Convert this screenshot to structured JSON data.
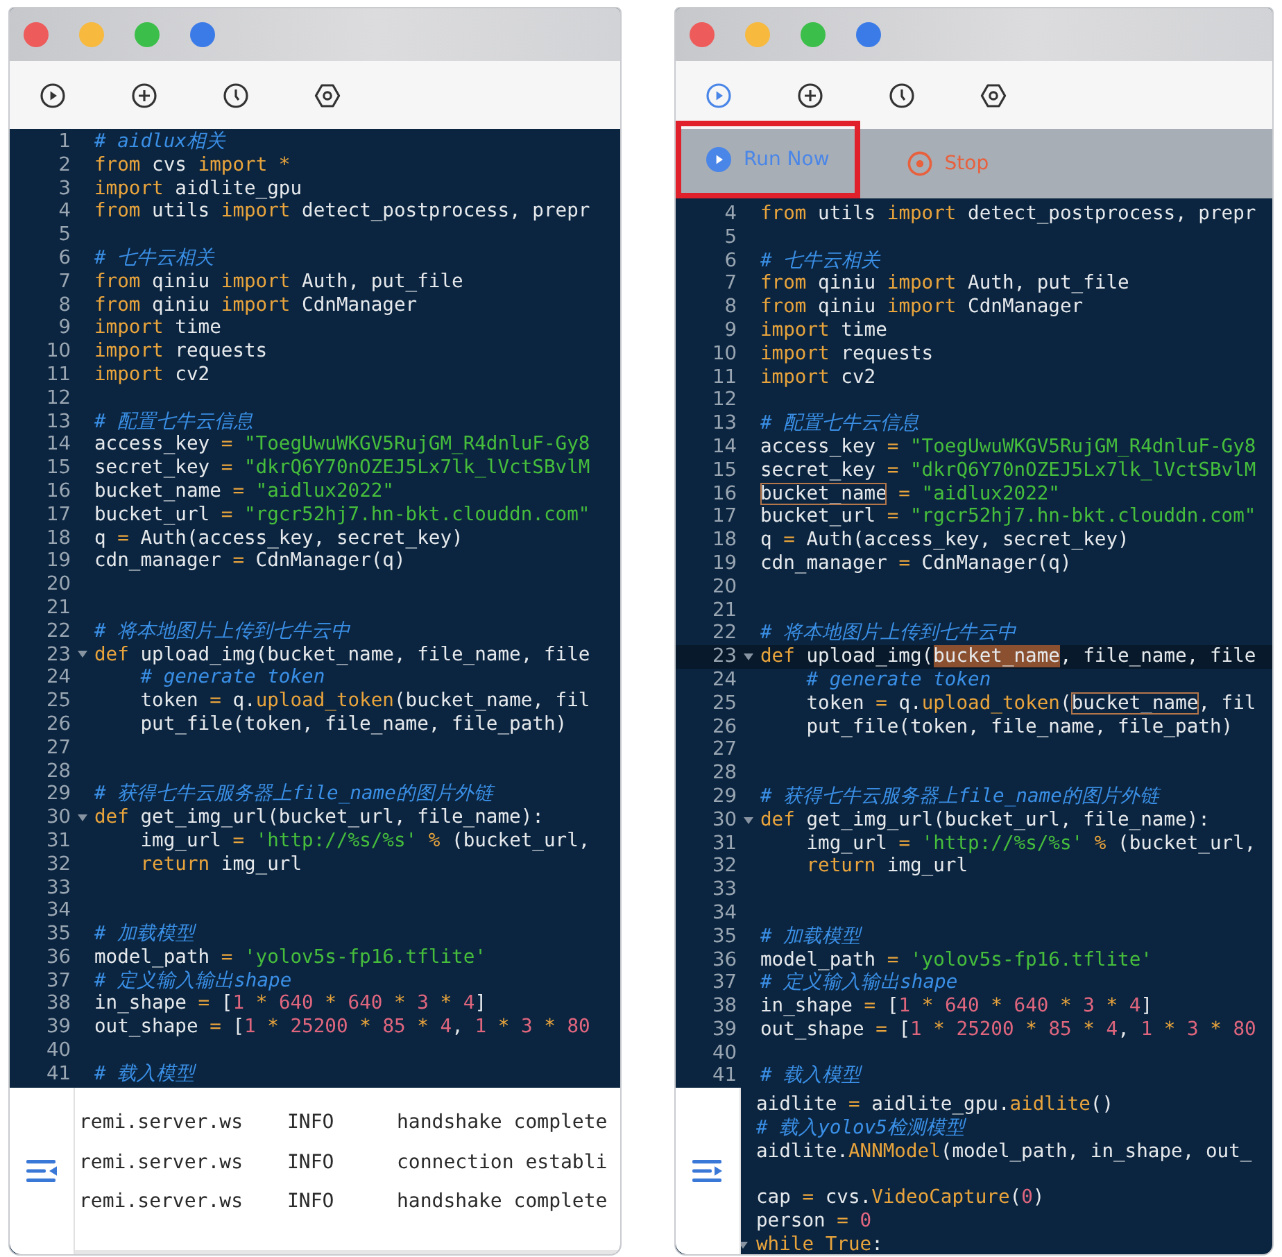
{
  "windows": [
    {
      "window_buttons": [
        {
          "color": "#ee5b5b"
        },
        {
          "color": "#f7b93e"
        },
        {
          "color": "#3cbf4a"
        },
        {
          "color": "#3b7be8"
        }
      ],
      "toolbar": [
        {
          "kind": "run",
          "selected": false
        },
        {
          "kind": "add",
          "selected": false
        },
        {
          "kind": "history",
          "selected": false
        },
        {
          "kind": "settings",
          "selected": false
        }
      ],
      "editor": {
        "lines": [
          {
            "number": "1",
            "foldable": false,
            "tokens": [
              {
                "text": "# aidlux相关",
                "kind": "comment"
              }
            ]
          },
          {
            "number": "2",
            "foldable": false,
            "tokens": [
              {
                "text": "from",
                "kind": "keyword"
              },
              {
                "text": " cvs ",
                "kind": "plain"
              },
              {
                "text": "import",
                "kind": "keyword"
              },
              {
                "text": " *",
                "kind": "operator"
              }
            ]
          },
          {
            "number": "3",
            "foldable": false,
            "tokens": [
              {
                "text": "import",
                "kind": "keyword"
              },
              {
                "text": " aidlite_gpu",
                "kind": "plain"
              }
            ]
          },
          {
            "number": "4",
            "foldable": false,
            "tokens": [
              {
                "text": "from",
                "kind": "keyword"
              },
              {
                "text": " utils ",
                "kind": "plain"
              },
              {
                "text": "import",
                "kind": "keyword"
              },
              {
                "text": " detect_postprocess, prepr",
                "kind": "plain"
              }
            ]
          },
          {
            "number": "5",
            "foldable": false
          },
          {
            "number": "6",
            "foldable": false,
            "tokens": [
              {
                "text": "# 七牛云相关",
                "kind": "comment"
              }
            ]
          },
          {
            "number": "7",
            "foldable": false,
            "tokens": [
              {
                "text": "from",
                "kind": "keyword"
              },
              {
                "text": " qiniu ",
                "kind": "plain"
              },
              {
                "text": "import",
                "kind": "keyword"
              },
              {
                "text": " Auth, put_file",
                "kind": "plain"
              }
            ]
          },
          {
            "number": "8",
            "foldable": false,
            "tokens": [
              {
                "text": "from",
                "kind": "keyword"
              },
              {
                "text": " qiniu ",
                "kind": "plain"
              },
              {
                "text": "import",
                "kind": "keyword"
              },
              {
                "text": " CdnManager",
                "kind": "plain"
              }
            ]
          },
          {
            "number": "9",
            "foldable": false,
            "tokens": [
              {
                "text": "import",
                "kind": "keyword"
              },
              {
                "text": " time",
                "kind": "plain"
              }
            ]
          },
          {
            "number": "10",
            "foldable": false,
            "tokens": [
              {
                "text": "import",
                "kind": "keyword"
              },
              {
                "text": " requests",
                "kind": "plain"
              }
            ]
          },
          {
            "number": "11",
            "foldable": false,
            "tokens": [
              {
                "text": "import",
                "kind": "keyword"
              },
              {
                "text": " cv2",
                "kind": "plain"
              }
            ]
          },
          {
            "number": "12",
            "foldable": false
          },
          {
            "number": "13",
            "foldable": false,
            "tokens": [
              {
                "text": "# 配置七牛云信息",
                "kind": "comment"
              }
            ]
          },
          {
            "number": "14",
            "foldable": false,
            "tokens": [
              {
                "text": "access_key ",
                "kind": "plain"
              },
              {
                "text": "=",
                "kind": "operator"
              },
              {
                "text": " \"ToegUwuWKGV5RujGM_R4dnluF-Gy8",
                "kind": "string"
              }
            ]
          },
          {
            "number": "15",
            "foldable": false,
            "tokens": [
              {
                "text": "secret_key ",
                "kind": "plain"
              },
              {
                "text": "=",
                "kind": "operator"
              },
              {
                "text": " \"dkrQ6Y70nOZEJ5Lx7lk_lVctSBvlM",
                "kind": "string"
              }
            ]
          },
          {
            "number": "16",
            "foldable": false,
            "tokens": [
              {
                "text": "bucket_name ",
                "kind": "plain"
              },
              {
                "text": "=",
                "kind": "operator"
              },
              {
                "text": " \"aidlux2022\"",
                "kind": "string"
              }
            ]
          },
          {
            "number": "17",
            "foldable": false,
            "tokens": [
              {
                "text": "bucket_url ",
                "kind": "plain"
              },
              {
                "text": "=",
                "kind": "operator"
              },
              {
                "text": " \"rgcr52hj7.hn-bkt.clouddn.com\"",
                "kind": "string"
              }
            ]
          },
          {
            "number": "18",
            "foldable": false,
            "tokens": [
              {
                "text": "q ",
                "kind": "plain"
              },
              {
                "text": "=",
                "kind": "operator"
              },
              {
                "text": " Auth(access_key, secret_key)",
                "kind": "plain"
              }
            ]
          },
          {
            "number": "19",
            "foldable": false,
            "tokens": [
              {
                "text": "cdn_manager ",
                "kind": "plain"
              },
              {
                "text": "=",
                "kind": "operator"
              },
              {
                "text": " CdnManager(q)",
                "kind": "plain"
              }
            ]
          },
          {
            "number": "20",
            "foldable": false
          },
          {
            "number": "21",
            "foldable": false
          },
          {
            "number": "22",
            "foldable": false,
            "tokens": [
              {
                "text": "# 将本地图片上传到七牛云中",
                "kind": "comment"
              }
            ]
          },
          {
            "number": "23",
            "foldable": true,
            "tokens": [
              {
                "text": "def",
                "kind": "keyword"
              },
              {
                "text": " upload_img(bucket_name, file_name, file",
                "kind": "plain"
              }
            ]
          },
          {
            "number": "24",
            "foldable": false,
            "tokens": [
              {
                "text": "    # generate token",
                "kind": "comment"
              }
            ]
          },
          {
            "number": "25",
            "foldable": false,
            "tokens": [
              {
                "text": "    token ",
                "kind": "plain"
              },
              {
                "text": "=",
                "kind": "operator"
              },
              {
                "text": " q.",
                "kind": "plain"
              },
              {
                "text": "upload_token",
                "kind": "call"
              },
              {
                "text": "(bucket_name, fil",
                "kind": "plain"
              }
            ]
          },
          {
            "number": "26",
            "foldable": false,
            "tokens": [
              {
                "text": "    put_file(token, file_name, file_path)",
                "kind": "plain"
              }
            ]
          },
          {
            "number": "27",
            "foldable": false
          },
          {
            "number": "28",
            "foldable": false
          },
          {
            "number": "29",
            "foldable": false,
            "tokens": [
              {
                "text": "# 获得七牛云服务器上file_name的图片外链",
                "kind": "comment"
              }
            ]
          },
          {
            "number": "30",
            "foldable": true,
            "tokens": [
              {
                "text": "def",
                "kind": "keyword"
              },
              {
                "text": " get_img_url(bucket_url, file_name):",
                "kind": "plain"
              }
            ]
          },
          {
            "number": "31",
            "foldable": false,
            "tokens": [
              {
                "text": "    img_url ",
                "kind": "plain"
              },
              {
                "text": "=",
                "kind": "operator"
              },
              {
                "text": " 'http://%s/%s'",
                "kind": "string"
              },
              {
                "text": " %",
                "kind": "operator"
              },
              {
                "text": " (bucket_url,",
                "kind": "plain"
              }
            ]
          },
          {
            "number": "32",
            "foldable": false,
            "tokens": [
              {
                "text": "    return",
                "kind": "keyword"
              },
              {
                "text": " img_url",
                "kind": "plain"
              }
            ]
          },
          {
            "number": "33",
            "foldable": false
          },
          {
            "number": "34",
            "foldable": false
          },
          {
            "number": "35",
            "foldable": false,
            "tokens": [
              {
                "text": "# 加载模型",
                "kind": "comment"
              }
            ]
          },
          {
            "number": "36",
            "foldable": false,
            "tokens": [
              {
                "text": "model_path ",
                "kind": "plain"
              },
              {
                "text": "=",
                "kind": "operator"
              },
              {
                "text": " 'yolov5s-fp16.tflite'",
                "kind": "string"
              }
            ]
          },
          {
            "number": "37",
            "foldable": false,
            "tokens": [
              {
                "text": "# 定义输入输出shape",
                "kind": "comment"
              }
            ]
          },
          {
            "number": "38",
            "foldable": false,
            "tokens": [
              {
                "text": "in_shape ",
                "kind": "plain"
              },
              {
                "text": "=",
                "kind": "operator"
              },
              {
                "text": " [",
                "kind": "plain"
              },
              {
                "text": "1",
                "kind": "number"
              },
              {
                "text": " *",
                "kind": "operator"
              },
              {
                "text": " 640",
                "kind": "number"
              },
              {
                "text": " *",
                "kind": "operator"
              },
              {
                "text": " 640",
                "kind": "number"
              },
              {
                "text": " *",
                "kind": "operator"
              },
              {
                "text": " 3",
                "kind": "number"
              },
              {
                "text": " *",
                "kind": "operator"
              },
              {
                "text": " 4",
                "kind": "number"
              },
              {
                "text": "]",
                "kind": "plain"
              }
            ]
          },
          {
            "number": "39",
            "foldable": false,
            "tokens": [
              {
                "text": "out_shape ",
                "kind": "plain"
              },
              {
                "text": "=",
                "kind": "operator"
              },
              {
                "text": " [",
                "kind": "plain"
              },
              {
                "text": "1",
                "kind": "number"
              },
              {
                "text": " *",
                "kind": "operator"
              },
              {
                "text": " 25200",
                "kind": "number"
              },
              {
                "text": " *",
                "kind": "operator"
              },
              {
                "text": " 85",
                "kind": "number"
              },
              {
                "text": " *",
                "kind": "operator"
              },
              {
                "text": " 4",
                "kind": "number"
              },
              {
                "text": ",",
                "kind": "plain"
              },
              {
                "text": " 1",
                "kind": "number"
              },
              {
                "text": " *",
                "kind": "operator"
              },
              {
                "text": " 3",
                "kind": "number"
              },
              {
                "text": " *",
                "kind": "operator"
              },
              {
                "text": " 80",
                "kind": "number"
              }
            ]
          },
          {
            "number": "40",
            "foldable": false
          },
          {
            "number": "41",
            "foldable": false,
            "tokens": [
              {
                "text": "# 载入模型",
                "kind": "comment"
              }
            ]
          }
        ]
      },
      "log_panel": {
        "expanded": true,
        "rows": [
          {
            "logger": "remi.server.ws",
            "severity": "INFO",
            "message": "handshake complete"
          },
          {
            "logger": "remi.server.ws",
            "severity": "INFO",
            "message": "connection establi"
          },
          {
            "logger": "remi.server.ws",
            "severity": "INFO",
            "message": "handshake complete"
          }
        ]
      }
    },
    {
      "window_buttons": [
        {
          "color": "#ee5b5b"
        },
        {
          "color": "#f7b93e"
        },
        {
          "color": "#3cbf4a"
        },
        {
          "color": "#3b7be8"
        }
      ],
      "toolbar": [
        {
          "kind": "run",
          "selected": true
        },
        {
          "kind": "add",
          "selected": false
        },
        {
          "kind": "history",
          "selected": false
        },
        {
          "kind": "settings",
          "selected": false
        }
      ],
      "action_bar": [
        {
          "kind": "run",
          "label": "Run Now",
          "highlighted": true
        },
        {
          "kind": "stop",
          "label": "Stop",
          "highlighted": false
        }
      ],
      "editor": {
        "lines": [
          {
            "number": "4",
            "foldable": false,
            "current": false,
            "tokens": [
              {
                "text": "from",
                "kind": "keyword"
              },
              {
                "text": " utils ",
                "kind": "plain"
              },
              {
                "text": "import",
                "kind": "keyword"
              },
              {
                "text": " detect_postprocess, prepr",
                "kind": "plain"
              }
            ]
          },
          {
            "number": "5",
            "foldable": false,
            "current": false
          },
          {
            "number": "6",
            "foldable": false,
            "current": false,
            "tokens": [
              {
                "text": "# 七牛云相关",
                "kind": "comment"
              }
            ]
          },
          {
            "number": "7",
            "foldable": false,
            "current": false,
            "tokens": [
              {
                "text": "from",
                "kind": "keyword"
              },
              {
                "text": " qiniu ",
                "kind": "plain"
              },
              {
                "text": "import",
                "kind": "keyword"
              },
              {
                "text": " Auth, put_file",
                "kind": "plain"
              }
            ]
          },
          {
            "number": "8",
            "foldable": false,
            "current": false,
            "tokens": [
              {
                "text": "from",
                "kind": "keyword"
              },
              {
                "text": " qiniu ",
                "kind": "plain"
              },
              {
                "text": "import",
                "kind": "keyword"
              },
              {
                "text": " CdnManager",
                "kind": "plain"
              }
            ]
          },
          {
            "number": "9",
            "foldable": false,
            "current": false,
            "tokens": [
              {
                "text": "import",
                "kind": "keyword"
              },
              {
                "text": " time",
                "kind": "plain"
              }
            ]
          },
          {
            "number": "10",
            "foldable": false,
            "current": false,
            "tokens": [
              {
                "text": "import",
                "kind": "keyword"
              },
              {
                "text": " requests",
                "kind": "plain"
              }
            ]
          },
          {
            "number": "11",
            "foldable": false,
            "current": false,
            "tokens": [
              {
                "text": "import",
                "kind": "keyword"
              },
              {
                "text": " cv2",
                "kind": "plain"
              }
            ]
          },
          {
            "number": "12",
            "foldable": false,
            "current": false
          },
          {
            "number": "13",
            "foldable": false,
            "current": false,
            "tokens": [
              {
                "text": "# 配置七牛云信息",
                "kind": "comment"
              }
            ]
          },
          {
            "number": "14",
            "foldable": false,
            "current": false,
            "tokens": [
              {
                "text": "access_key ",
                "kind": "plain"
              },
              {
                "text": "=",
                "kind": "operator"
              },
              {
                "text": " \"ToegUwuWKGV5RujGM_R4dnluF-Gy8",
                "kind": "string"
              }
            ]
          },
          {
            "number": "15",
            "foldable": false,
            "current": false,
            "tokens": [
              {
                "text": "secret_key ",
                "kind": "plain"
              },
              {
                "text": "=",
                "kind": "operator"
              },
              {
                "text": " \"dkrQ6Y70nOZEJ5Lx7lk_lVctSBvlM",
                "kind": "string"
              }
            ]
          },
          {
            "number": "16",
            "foldable": false,
            "current": false,
            "tokens": [
              {
                "text": "bucket_name",
                "kind": "plain",
                "matched": true
              },
              {
                "text": " =",
                "kind": "operator"
              },
              {
                "text": " \"aidlux2022\"",
                "kind": "string"
              }
            ]
          },
          {
            "number": "17",
            "foldable": false,
            "current": false,
            "tokens": [
              {
                "text": "bucket_url ",
                "kind": "plain"
              },
              {
                "text": "=",
                "kind": "operator"
              },
              {
                "text": " \"rgcr52hj7.hn-bkt.clouddn.com\"",
                "kind": "string"
              }
            ]
          },
          {
            "number": "18",
            "foldable": false,
            "current": false,
            "tokens": [
              {
                "text": "q ",
                "kind": "plain"
              },
              {
                "text": "=",
                "kind": "operator"
              },
              {
                "text": " Auth(access_key, secret_key)",
                "kind": "plain"
              }
            ]
          },
          {
            "number": "19",
            "foldable": false,
            "current": false,
            "tokens": [
              {
                "text": "cdn_manager ",
                "kind": "plain"
              },
              {
                "text": "=",
                "kind": "operator"
              },
              {
                "text": " CdnManager(q)",
                "kind": "plain"
              }
            ]
          },
          {
            "number": "20",
            "foldable": false,
            "current": false
          },
          {
            "number": "21",
            "foldable": false,
            "current": false
          },
          {
            "number": "22",
            "foldable": false,
            "current": false,
            "tokens": [
              {
                "text": "# 将本地图片上传到七牛云中",
                "kind": "comment"
              }
            ]
          },
          {
            "number": "23",
            "foldable": true,
            "current": true,
            "tokens": [
              {
                "text": "def",
                "kind": "keyword"
              },
              {
                "text": " upload_img(",
                "kind": "plain"
              },
              {
                "text": "bucket_name",
                "kind": "plain",
                "selected": true
              },
              {
                "text": ", file_name, file",
                "kind": "plain"
              }
            ]
          },
          {
            "number": "24",
            "foldable": false,
            "current": false,
            "tokens": [
              {
                "text": "    # generate token",
                "kind": "comment"
              }
            ]
          },
          {
            "number": "25",
            "foldable": false,
            "current": false,
            "tokens": [
              {
                "text": "    token ",
                "kind": "plain"
              },
              {
                "text": "=",
                "kind": "operator"
              },
              {
                "text": " q.",
                "kind": "plain"
              },
              {
                "text": "upload_token",
                "kind": "call"
              },
              {
                "text": "(",
                "kind": "plain"
              },
              {
                "text": "bucket_name",
                "kind": "plain",
                "matched": true
              },
              {
                "text": ", fil",
                "kind": "plain"
              }
            ]
          },
          {
            "number": "26",
            "foldable": false,
            "current": false,
            "tokens": [
              {
                "text": "    put_file(token, file_name, file_path)",
                "kind": "plain"
              }
            ]
          },
          {
            "number": "27",
            "foldable": false,
            "current": false
          },
          {
            "number": "28",
            "foldable": false,
            "current": false
          },
          {
            "number": "29",
            "foldable": false,
            "current": false,
            "tokens": [
              {
                "text": "# 获得七牛云服务器上file_name的图片外链",
                "kind": "comment"
              }
            ]
          },
          {
            "number": "30",
            "foldable": true,
            "current": false,
            "tokens": [
              {
                "text": "def",
                "kind": "keyword"
              },
              {
                "text": " get_img_url(bucket_url, file_name):",
                "kind": "plain"
              }
            ]
          },
          {
            "number": "31",
            "foldable": false,
            "current": false,
            "tokens": [
              {
                "text": "    img_url ",
                "kind": "plain"
              },
              {
                "text": "=",
                "kind": "operator"
              },
              {
                "text": " 'http://%s/%s'",
                "kind": "string"
              },
              {
                "text": " %",
                "kind": "operator"
              },
              {
                "text": " (bucket_url,",
                "kind": "plain"
              }
            ]
          },
          {
            "number": "32",
            "foldable": false,
            "current": false,
            "tokens": [
              {
                "text": "    return",
                "kind": "keyword"
              },
              {
                "text": " img_url",
                "kind": "plain"
              }
            ]
          },
          {
            "number": "33",
            "foldable": false,
            "current": false
          },
          {
            "number": "34",
            "foldable": false,
            "current": false
          },
          {
            "number": "35",
            "foldable": false,
            "current": false,
            "tokens": [
              {
                "text": "# 加载模型",
                "kind": "comment"
              }
            ]
          },
          {
            "number": "36",
            "foldable": false,
            "current": false,
            "tokens": [
              {
                "text": "model_path ",
                "kind": "plain"
              },
              {
                "text": "=",
                "kind": "operator"
              },
              {
                "text": " 'yolov5s-fp16.tflite'",
                "kind": "string"
              }
            ]
          },
          {
            "number": "37",
            "foldable": false,
            "current": false,
            "tokens": [
              {
                "text": "# 定义输入输出shape",
                "kind": "comment"
              }
            ]
          },
          {
            "number": "38",
            "foldable": false,
            "current": false,
            "tokens": [
              {
                "text": "in_shape ",
                "kind": "plain"
              },
              {
                "text": "=",
                "kind": "operator"
              },
              {
                "text": " [",
                "kind": "plain"
              },
              {
                "text": "1",
                "kind": "number"
              },
              {
                "text": " *",
                "kind": "operator"
              },
              {
                "text": " 640",
                "kind": "number"
              },
              {
                "text": " *",
                "kind": "operator"
              },
              {
                "text": " 640",
                "kind": "number"
              },
              {
                "text": " *",
                "kind": "operator"
              },
              {
                "text": " 3",
                "kind": "number"
              },
              {
                "text": " *",
                "kind": "operator"
              },
              {
                "text": " 4",
                "kind": "number"
              },
              {
                "text": "]",
                "kind": "plain"
              }
            ]
          },
          {
            "number": "39",
            "foldable": false,
            "current": false,
            "tokens": [
              {
                "text": "out_shape ",
                "kind": "plain"
              },
              {
                "text": "=",
                "kind": "operator"
              },
              {
                "text": " [",
                "kind": "plain"
              },
              {
                "text": "1",
                "kind": "number"
              },
              {
                "text": " *",
                "kind": "operator"
              },
              {
                "text": " 25200",
                "kind": "number"
              },
              {
                "text": " *",
                "kind": "operator"
              },
              {
                "text": " 85",
                "kind": "number"
              },
              {
                "text": " *",
                "kind": "operator"
              },
              {
                "text": " 4",
                "kind": "number"
              },
              {
                "text": ",",
                "kind": "plain"
              },
              {
                "text": " 1",
                "kind": "number"
              },
              {
                "text": " *",
                "kind": "operator"
              },
              {
                "text": " 3",
                "kind": "number"
              },
              {
                "text": " *",
                "kind": "operator"
              },
              {
                "text": " 80",
                "kind": "number"
              }
            ]
          },
          {
            "number": "40",
            "foldable": false,
            "current": false
          },
          {
            "number": "41",
            "foldable": false,
            "current": false,
            "tokens": [
              {
                "text": "# 载入模型",
                "kind": "comment"
              }
            ]
          }
        ],
        "lines_beside_panel": [
          {
            "foldable": false,
            "tokens": [
              {
                "text": "aidlite ",
                "kind": "plain"
              },
              {
                "text": "=",
                "kind": "operator"
              },
              {
                "text": " aidlite_gpu.",
                "kind": "plain"
              },
              {
                "text": "aidlite",
                "kind": "call"
              },
              {
                "text": "()",
                "kind": "plain"
              }
            ]
          },
          {
            "foldable": false,
            "tokens": [
              {
                "text": "# 载入yolov5检测模型",
                "kind": "comment"
              }
            ]
          },
          {
            "foldable": false,
            "tokens": [
              {
                "text": "aidlite.",
                "kind": "plain"
              },
              {
                "text": "ANNModel",
                "kind": "call"
              },
              {
                "text": "(model_path, in_shape, out_",
                "kind": "plain"
              }
            ]
          },
          {
            "foldable": false
          },
          {
            "foldable": false,
            "tokens": [
              {
                "text": "cap ",
                "kind": "plain"
              },
              {
                "text": "=",
                "kind": "operator"
              },
              {
                "text": " cvs.",
                "kind": "plain"
              },
              {
                "text": "VideoCapture",
                "kind": "call"
              },
              {
                "text": "(",
                "kind": "plain"
              },
              {
                "text": "0",
                "kind": "number"
              },
              {
                "text": ")",
                "kind": "plain"
              }
            ]
          },
          {
            "foldable": false,
            "tokens": [
              {
                "text": "person ",
                "kind": "plain"
              },
              {
                "text": "=",
                "kind": "operator"
              },
              {
                "text": " 0",
                "kind": "number"
              }
            ]
          },
          {
            "foldable": true,
            "tokens": [
              {
                "text": "while",
                "kind": "keyword"
              },
              {
                "text": " True",
                "kind": "keyword"
              },
              {
                "text": ":",
                "kind": "plain"
              }
            ]
          }
        ]
      },
      "log_panel": {
        "expanded": false
      }
    }
  ]
}
